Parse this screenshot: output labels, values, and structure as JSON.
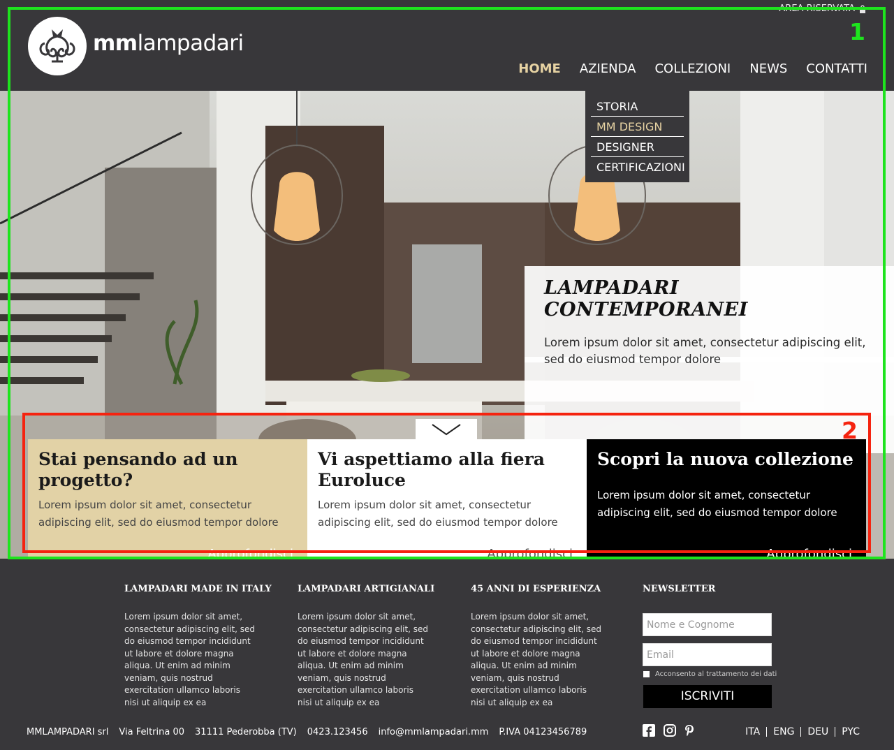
{
  "header": {
    "area_riservata": "AREA RISERVATA",
    "brand_bold": "mm",
    "brand_light": "lampadari",
    "nav": [
      {
        "label": "HOME",
        "active": true
      },
      {
        "label": "AZIENDA",
        "active": false
      },
      {
        "label": "COLLEZIONI",
        "active": false
      },
      {
        "label": "NEWS",
        "active": false
      },
      {
        "label": "CONTATTI",
        "active": false
      }
    ]
  },
  "dropdown": {
    "items": [
      {
        "label": "STORIA",
        "active": false
      },
      {
        "label": "MM DESIGN",
        "active": true
      },
      {
        "label": "DESIGNER",
        "active": false
      },
      {
        "label": "CERTIFICAZIONI",
        "active": false
      }
    ]
  },
  "hero": {
    "title": "LAMPADARI CONTEMPORANEI",
    "text": "Lorem ipsum dolor sit amet, consectetur adipiscing elit, sed do eiusmod tempor dolore"
  },
  "cards": [
    {
      "title": "Stai pensando ad un progetto?",
      "text": "Lorem ipsum dolor sit amet, consectetur adipiscing elit, sed do eiusmod tempor dolore",
      "link": "Approfondisci"
    },
    {
      "title": "Vi aspettiamo alla fiera Euroluce",
      "text": "Lorem ipsum dolor sit amet, consectetur adipiscing elit, sed do eiusmod tempor dolore",
      "link": "Approfondisci"
    },
    {
      "title": "Scopri la nuova collezione",
      "text": "Lorem ipsum dolor sit amet, consectetur adipiscing elit, sed do eiusmod tempor dolore",
      "link": "Approfondisci"
    }
  ],
  "annotations": {
    "label_1": "1",
    "label_2": "2"
  },
  "footer": {
    "columns": [
      {
        "title": "LAMPADARI MADE IN ITALY",
        "text": "Lorem ipsum dolor sit amet, consectetur adipiscing elit, sed do eiusmod tempor incididunt ut labore et dolore magna aliqua. Ut enim ad minim veniam, quis nostrud exercitation ullamco laboris nisi ut aliquip ex ea"
      },
      {
        "title": "LAMPADARI ARTIGIANALI",
        "text": "Lorem ipsum dolor sit amet, consectetur adipiscing elit, sed do eiusmod tempor incididunt ut labore et dolore magna aliqua. Ut enim ad minim veniam, quis nostrud exercitation ullamco laboris nisi ut aliquip ex ea"
      },
      {
        "title": "45 ANNI DI ESPERIENZA",
        "text": "Lorem ipsum dolor sit amet, consectetur adipiscing elit, sed do eiusmod tempor incididunt ut labore et dolore magna aliqua. Ut enim ad minim veniam, quis nostrud exercitation ullamco laboris nisi ut aliquip ex ea"
      }
    ],
    "newsletter": {
      "title": "NEWSLETTER",
      "name_placeholder": "Nome e Cognome",
      "email_placeholder": "Email",
      "consent": "Acconsento al trattamento dei dati",
      "button": "ISCRIVITI"
    },
    "info": {
      "company": "MMLAMPADARI srl",
      "address": "Via Feltrina 00",
      "city": "31111 Pederobba  (TV)",
      "phone": "0423.123456",
      "email": "info@mmlampadari.mm",
      "vat": "P.IVA 04123456789"
    },
    "social_icons": [
      "facebook-icon",
      "instagram-icon",
      "pinterest-icon"
    ],
    "languages": [
      "ITA",
      "ENG",
      "DEU",
      "PYC"
    ]
  },
  "colors": {
    "dark_bg": "#38373a",
    "gold_accent": "#e7d3a3",
    "beige_card": "#e2d2a6",
    "annotation_green": "#1ee41e",
    "annotation_red": "#f5230f"
  }
}
